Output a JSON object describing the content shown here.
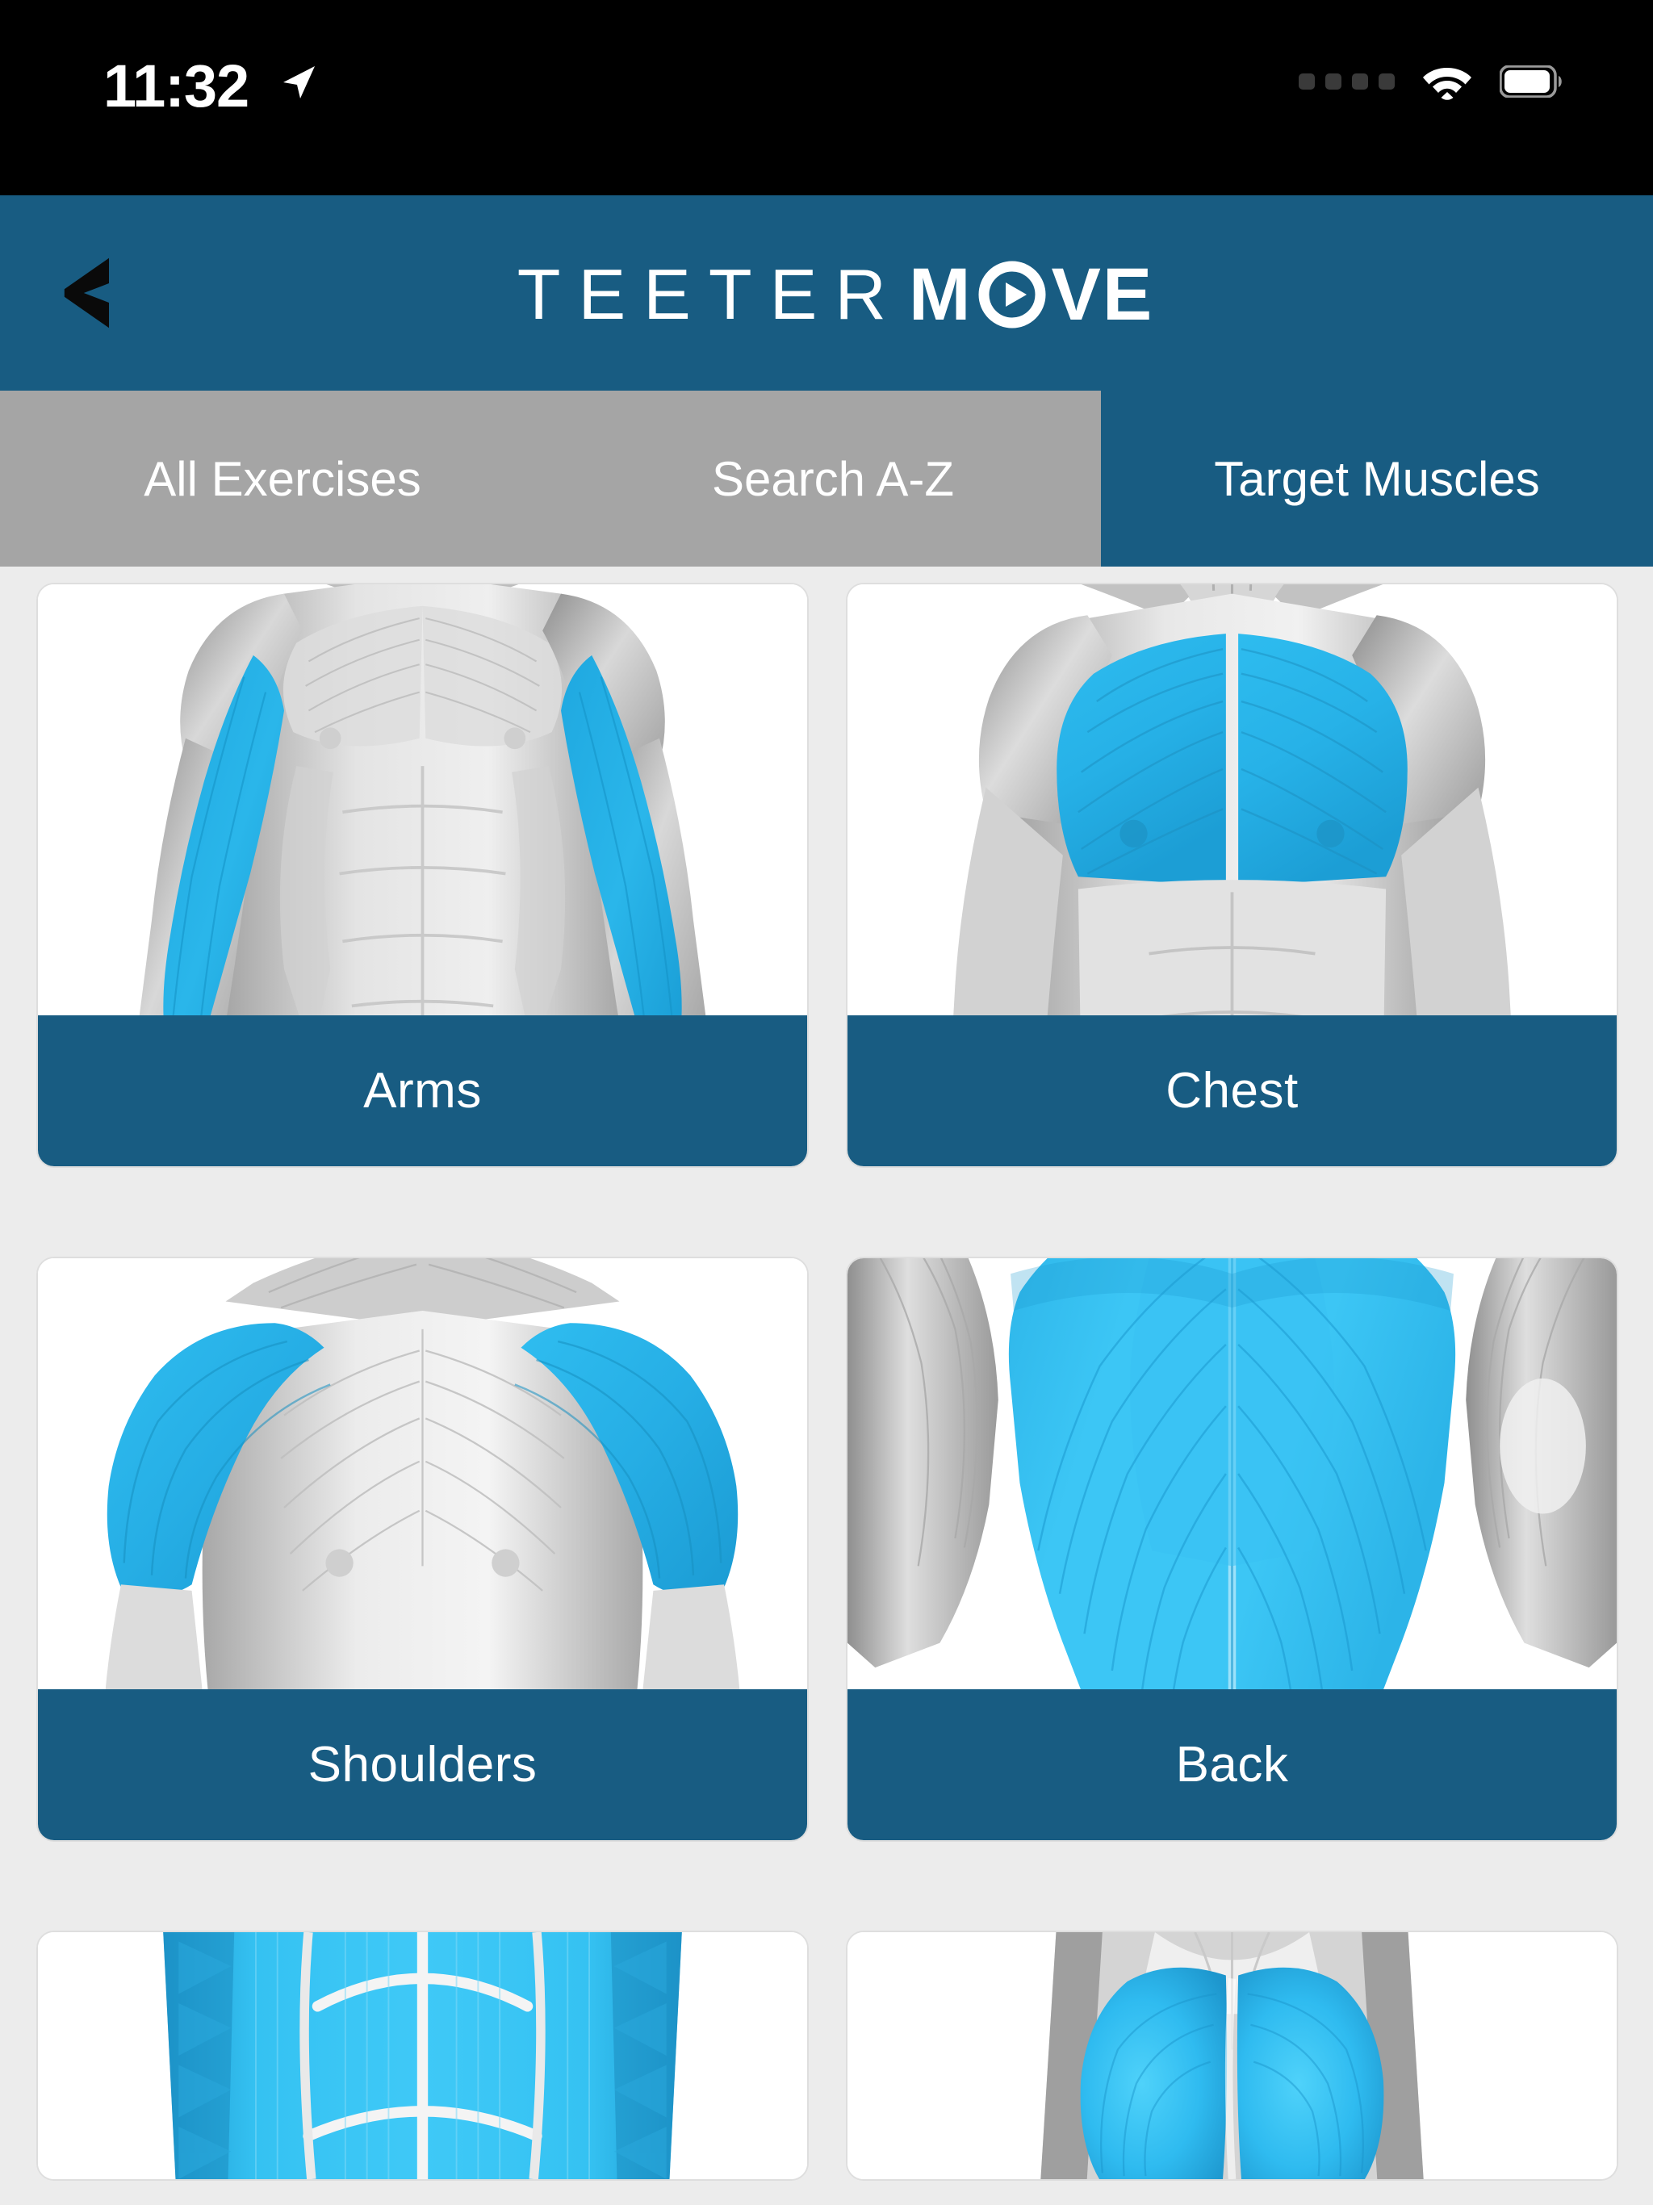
{
  "status_bar": {
    "time": "11:32",
    "location_icon": "location-arrow-icon",
    "cellular_icon": "cellular-signal-dots-icon",
    "wifi_icon": "wifi-icon",
    "battery_icon": "battery-icon"
  },
  "header": {
    "back_icon": "chevron-left-icon",
    "brand_primary": "TEETER",
    "brand_secondary_before": "M",
    "brand_play_icon": "play-circle-icon",
    "brand_secondary_after": "VE",
    "background_color": "#185c82"
  },
  "tabs": {
    "items": [
      {
        "label": "All Exercises",
        "active": false
      },
      {
        "label": "Search A-Z",
        "active": false
      },
      {
        "label": "Target Muscles",
        "active": true
      }
    ],
    "inactive_color": "#a5a5a5",
    "active_color": "#185c82"
  },
  "muscle_groups": {
    "highlight_color": "#29b0e6",
    "label_bar_color": "#185c82",
    "items": [
      {
        "label": "Arms",
        "view": "front",
        "region": "biceps",
        "partial": false
      },
      {
        "label": "Chest",
        "view": "front",
        "region": "pecs",
        "partial": false
      },
      {
        "label": "Shoulders",
        "view": "front",
        "region": "delts",
        "partial": false
      },
      {
        "label": "Back",
        "view": "back",
        "region": "lats",
        "partial": false
      },
      {
        "label": "",
        "view": "front",
        "region": "abs",
        "partial": true
      },
      {
        "label": "",
        "view": "back",
        "region": "glutes",
        "partial": true
      }
    ]
  }
}
